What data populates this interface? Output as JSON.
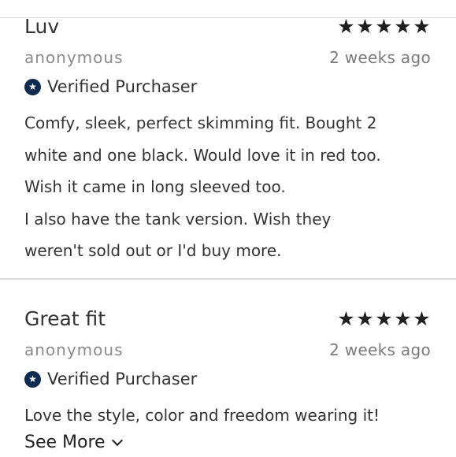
{
  "reviews": [
    {
      "title": "Luv",
      "rating": 5,
      "author": "anonymous",
      "date": "2 weeks ago",
      "verified_label": "Verified Purchaser",
      "body_lines": [
        "Comfy, sleek, perfect skimming fit. Bought 2",
        "white and one black. Would love it in red too.",
        "Wish it came in long sleeved too.",
        "I also have the tank version.  Wish they",
        "weren't sold out or I'd buy more."
      ]
    },
    {
      "title": "Great fit",
      "rating": 5,
      "author": "anonymous",
      "date": "2 weeks ago",
      "verified_label": "Verified Purchaser",
      "body_lines": [
        "Love the style, color and freedom wearing it!"
      ],
      "see_more_label": "See More"
    }
  ],
  "icons": {
    "star": "star-icon",
    "verified": "verified-star-badge-icon",
    "expand": "chevron-down-icon"
  },
  "colors": {
    "verified_badge": "#0d2a4f",
    "stars": "#1f1f1f",
    "meta_text": "#8a8a8a"
  }
}
